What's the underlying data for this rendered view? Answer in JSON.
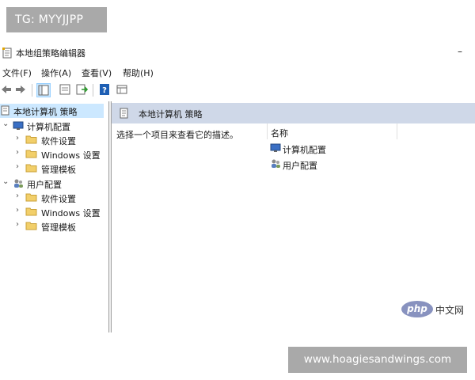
{
  "watermarks": {
    "tg": "TG: MYYJJPP",
    "site": "www.hoagiesandwings.com",
    "php_logo": "php",
    "php_site": "中文网"
  },
  "window": {
    "title": "本地组策略编辑器",
    "minimize": "–"
  },
  "menu": [
    {
      "label": "文件(F)"
    },
    {
      "label": "操作(A)"
    },
    {
      "label": "查看(V)"
    },
    {
      "label": "帮助(H)"
    }
  ],
  "toolbar": {
    "icons": [
      "back-arrow-icon",
      "forward-arrow-icon",
      "show-tree-icon",
      "properties-icon",
      "export-icon",
      "help-icon",
      "view-icon"
    ]
  },
  "tree": {
    "root": "本地计算机 策略",
    "computer": {
      "label": "计算机配置",
      "children": [
        "软件设置",
        "Windows 设置",
        "管理模板"
      ]
    },
    "user": {
      "label": "用户配置",
      "children": [
        "软件设置",
        "Windows 设置",
        "管理模板"
      ]
    }
  },
  "detail": {
    "header": "本地计算机 策略",
    "description": "选择一个项目来查看它的描述。",
    "column": "名称",
    "items": [
      "计算机配置",
      "用户配置"
    ]
  }
}
